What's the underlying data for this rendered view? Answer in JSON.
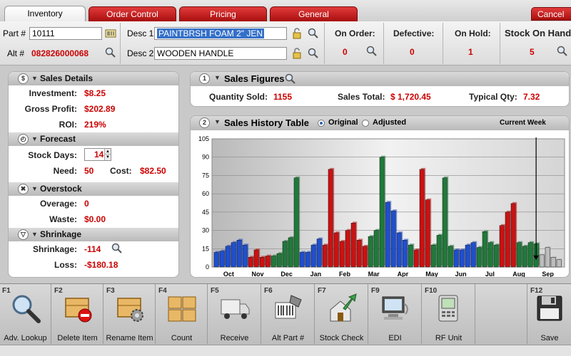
{
  "tabs": [
    {
      "label": "Inventory",
      "active": true
    },
    {
      "label": "Order Control",
      "active": false
    },
    {
      "label": "Pricing",
      "active": false
    },
    {
      "label": "General",
      "active": false
    }
  ],
  "cancel_label": "Cancel",
  "header": {
    "part_label": "Part #",
    "part_value": "10111",
    "alt_label": "Alt #",
    "alt_value": "082826000068",
    "desc1_label": "Desc 1",
    "desc1_value": "PAINTBRSH FOAM 2\" JEN",
    "desc2_label": "Desc 2",
    "desc2_value": "WOODEN HANDLE",
    "on_order_label": "On Order:",
    "on_order_value": "0",
    "defective_label": "Defective:",
    "defective_value": "0",
    "on_hold_label": "On Hold:",
    "on_hold_value": "1",
    "stock_label": "Stock On Hand",
    "stock_value": "5"
  },
  "sales_details": {
    "title": "Sales Details",
    "investment_label": "Investment:",
    "investment_value": "$8.25",
    "gross_profit_label": "Gross Profit:",
    "gross_profit_value": "$202.89",
    "roi_label": "ROI:",
    "roi_value": "219%"
  },
  "forecast": {
    "title": "Forecast",
    "stock_days_label": "Stock Days:",
    "stock_days_value": "14",
    "need_label": "Need:",
    "need_value": "50",
    "cost_label": "Cost:",
    "cost_value": "$82.50"
  },
  "overstock": {
    "title": "Overstock",
    "overage_label": "Overage:",
    "overage_value": "0",
    "waste_label": "Waste:",
    "waste_value": "$0.00"
  },
  "shrinkage": {
    "title": "Shrinkage",
    "shrinkage_label": "Shrinkage:",
    "shrinkage_value": "-114",
    "loss_label": "Loss:",
    "loss_value": "-$180.18"
  },
  "sales_figures": {
    "number": "1",
    "title": "Sales Figures",
    "qty_sold_label": "Quantity Sold:",
    "qty_sold_value": "1155",
    "sales_total_label": "Sales Total:",
    "sales_total_value": "$ 1,720.45",
    "typical_qty_label": "Typical Qty:",
    "typical_qty_value": "7.32"
  },
  "history": {
    "number": "2",
    "title": "Sales History Table",
    "original_label": "Original",
    "adjusted_label": "Adjusted",
    "current_week_label": "Current Week"
  },
  "section_numbers": {
    "sales_details": "$",
    "forecast": "◴",
    "overstock": "✖",
    "shrinkage": "▽"
  },
  "chart_data": {
    "type": "bar",
    "title": "",
    "xlabel": "",
    "ylabel": "",
    "ylim": [
      0,
      105
    ],
    "yticks": [
      0,
      15,
      30,
      45,
      60,
      75,
      90,
      105
    ],
    "xticks": [
      "Oct",
      "Nov",
      "Dec",
      "Jan",
      "Feb",
      "Mar",
      "Apr",
      "May",
      "Jun",
      "Jul",
      "Aug",
      "Sep"
    ],
    "grid": true,
    "colors": {
      "blue": "#1f4fd0",
      "red": "#cc1111",
      "green": "#1f7a3a",
      "gray": "#bdbdbd"
    },
    "bars": [
      {
        "v": 12,
        "c": "blue"
      },
      {
        "v": 13,
        "c": "blue"
      },
      {
        "v": 17,
        "c": "blue"
      },
      {
        "v": 20,
        "c": "blue"
      },
      {
        "v": 22,
        "c": "blue"
      },
      {
        "v": 18,
        "c": "blue"
      },
      {
        "v": 8,
        "c": "red"
      },
      {
        "v": 14,
        "c": "red"
      },
      {
        "v": 8,
        "c": "red"
      },
      {
        "v": 9,
        "c": "red"
      },
      {
        "v": 9,
        "c": "green"
      },
      {
        "v": 11,
        "c": "green"
      },
      {
        "v": 21,
        "c": "green"
      },
      {
        "v": 24,
        "c": "green"
      },
      {
        "v": 73,
        "c": "green"
      },
      {
        "v": 12,
        "c": "blue"
      },
      {
        "v": 12,
        "c": "blue"
      },
      {
        "v": 18,
        "c": "blue"
      },
      {
        "v": 23,
        "c": "blue"
      },
      {
        "v": 18,
        "c": "red"
      },
      {
        "v": 80,
        "c": "red"
      },
      {
        "v": 28,
        "c": "red"
      },
      {
        "v": 21,
        "c": "red"
      },
      {
        "v": 30,
        "c": "red"
      },
      {
        "v": 36,
        "c": "red"
      },
      {
        "v": 22,
        "c": "red"
      },
      {
        "v": 17,
        "c": "red"
      },
      {
        "v": 25,
        "c": "green"
      },
      {
        "v": 30,
        "c": "green"
      },
      {
        "v": 90,
        "c": "green"
      },
      {
        "v": 53,
        "c": "blue"
      },
      {
        "v": 46,
        "c": "blue"
      },
      {
        "v": 28,
        "c": "blue"
      },
      {
        "v": 22,
        "c": "blue"
      },
      {
        "v": 18,
        "c": "green"
      },
      {
        "v": 14,
        "c": "red"
      },
      {
        "v": 80,
        "c": "red"
      },
      {
        "v": 55,
        "c": "red"
      },
      {
        "v": 18,
        "c": "green"
      },
      {
        "v": 26,
        "c": "green"
      },
      {
        "v": 73,
        "c": "green"
      },
      {
        "v": 17,
        "c": "green"
      },
      {
        "v": 14,
        "c": "blue"
      },
      {
        "v": 14,
        "c": "blue"
      },
      {
        "v": 18,
        "c": "blue"
      },
      {
        "v": 20,
        "c": "blue"
      },
      {
        "v": 16,
        "c": "green"
      },
      {
        "v": 29,
        "c": "green"
      },
      {
        "v": 20,
        "c": "green"
      },
      {
        "v": 18,
        "c": "green"
      },
      {
        "v": 34,
        "c": "red"
      },
      {
        "v": 45,
        "c": "red"
      },
      {
        "v": 52,
        "c": "red"
      },
      {
        "v": 20,
        "c": "green"
      },
      {
        "v": 17,
        "c": "green"
      },
      {
        "v": 20,
        "c": "green"
      },
      {
        "v": 19,
        "c": "green"
      },
      {
        "v": 10,
        "c": "gray"
      },
      {
        "v": 16,
        "c": "gray"
      },
      {
        "v": 8,
        "c": "gray"
      },
      {
        "v": 6,
        "c": "gray"
      }
    ],
    "current_week_index": 56
  },
  "toolbar": [
    {
      "key": "F1",
      "label": "Adv. Lookup",
      "icon": "magnifier-icon"
    },
    {
      "key": "F2",
      "label": "Delete Item",
      "icon": "box-delete-icon"
    },
    {
      "key": "F3",
      "label": "Rename Item",
      "icon": "box-gear-icon"
    },
    {
      "key": "F4",
      "label": "Count",
      "icon": "boxes-icon"
    },
    {
      "key": "F5",
      "label": "Receive",
      "icon": "truck-icon"
    },
    {
      "key": "F6",
      "label": "Alt Part #",
      "icon": "barcode-scanner-icon"
    },
    {
      "key": "F7",
      "label": "Stock Check",
      "icon": "house-arrow-icon"
    },
    {
      "key": "F9",
      "label": "EDI",
      "icon": "computer-icon"
    },
    {
      "key": "F10",
      "label": "RF Unit",
      "icon": "handheld-icon"
    },
    {
      "key": "F12",
      "label": "Save",
      "icon": "floppy-disk-icon"
    }
  ]
}
